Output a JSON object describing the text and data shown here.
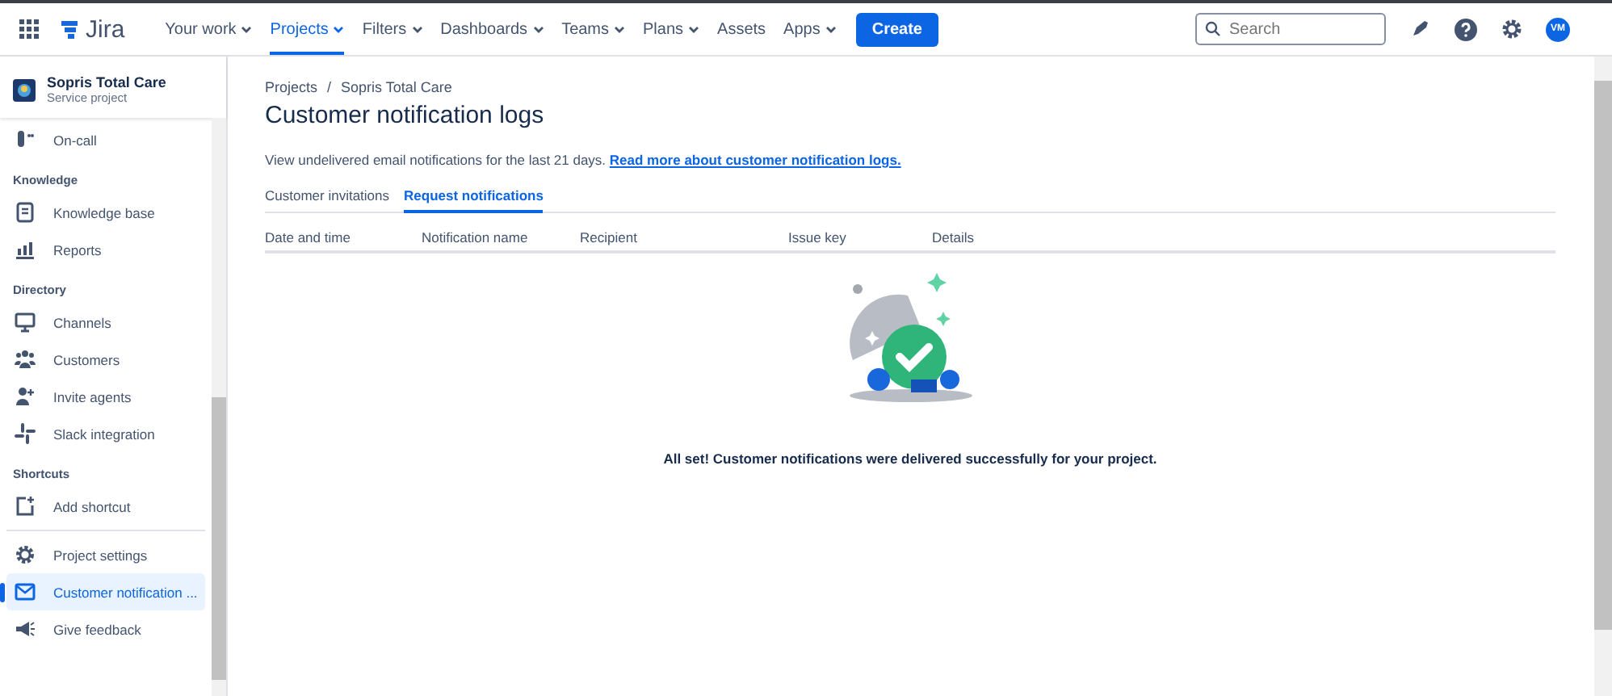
{
  "topbar": {
    "product": "Jira",
    "nav": [
      {
        "label": "Your work",
        "dropdown": true,
        "selected": false
      },
      {
        "label": "Projects",
        "dropdown": true,
        "selected": true
      },
      {
        "label": "Filters",
        "dropdown": true,
        "selected": false
      },
      {
        "label": "Dashboards",
        "dropdown": true,
        "selected": false
      },
      {
        "label": "Teams",
        "dropdown": true,
        "selected": false
      },
      {
        "label": "Plans",
        "dropdown": true,
        "selected": false
      },
      {
        "label": "Assets",
        "dropdown": false,
        "selected": false
      },
      {
        "label": "Apps",
        "dropdown": true,
        "selected": false
      }
    ],
    "create": "Create",
    "search": {
      "placeholder": "Search"
    },
    "avatar": "VM"
  },
  "sidebar": {
    "project": {
      "name": "Sopris Total Care",
      "type": "Service project"
    },
    "items": [
      {
        "kind": "item",
        "label": "On-call",
        "selected": false
      },
      {
        "kind": "heading",
        "label": "Knowledge"
      },
      {
        "kind": "item",
        "label": "Knowledge base",
        "selected": false
      },
      {
        "kind": "item",
        "label": "Reports",
        "selected": false
      },
      {
        "kind": "heading",
        "label": "Directory"
      },
      {
        "kind": "item",
        "label": "Channels",
        "selected": false
      },
      {
        "kind": "item",
        "label": "Customers",
        "selected": false
      },
      {
        "kind": "item",
        "label": "Invite agents",
        "selected": false
      },
      {
        "kind": "item",
        "label": "Slack integration",
        "selected": false
      },
      {
        "kind": "heading",
        "label": "Shortcuts"
      },
      {
        "kind": "item",
        "label": "Add shortcut",
        "selected": false
      },
      {
        "kind": "divider"
      },
      {
        "kind": "item",
        "label": "Project settings",
        "selected": false
      },
      {
        "kind": "item",
        "label": "Customer notification ...",
        "selected": true
      },
      {
        "kind": "item",
        "label": "Give feedback",
        "selected": false
      }
    ]
  },
  "breadcrumbs": [
    "Projects",
    "Sopris Total Care"
  ],
  "breadcrumb_separator": "/",
  "title": "Customer notification logs",
  "description": {
    "text": "View undelivered email notifications for the last 21 days.",
    "link": "Read more about customer notification logs."
  },
  "tabs": [
    {
      "label": "Customer invitations",
      "selected": false
    },
    {
      "label": "Request notifications",
      "selected": true
    }
  ],
  "table": {
    "columns": [
      "Date and time",
      "Notification name",
      "Recipient",
      "Issue key",
      "Details"
    ]
  },
  "empty_state": {
    "message": "All set! Customer notifications were delivered successfully for your project."
  }
}
